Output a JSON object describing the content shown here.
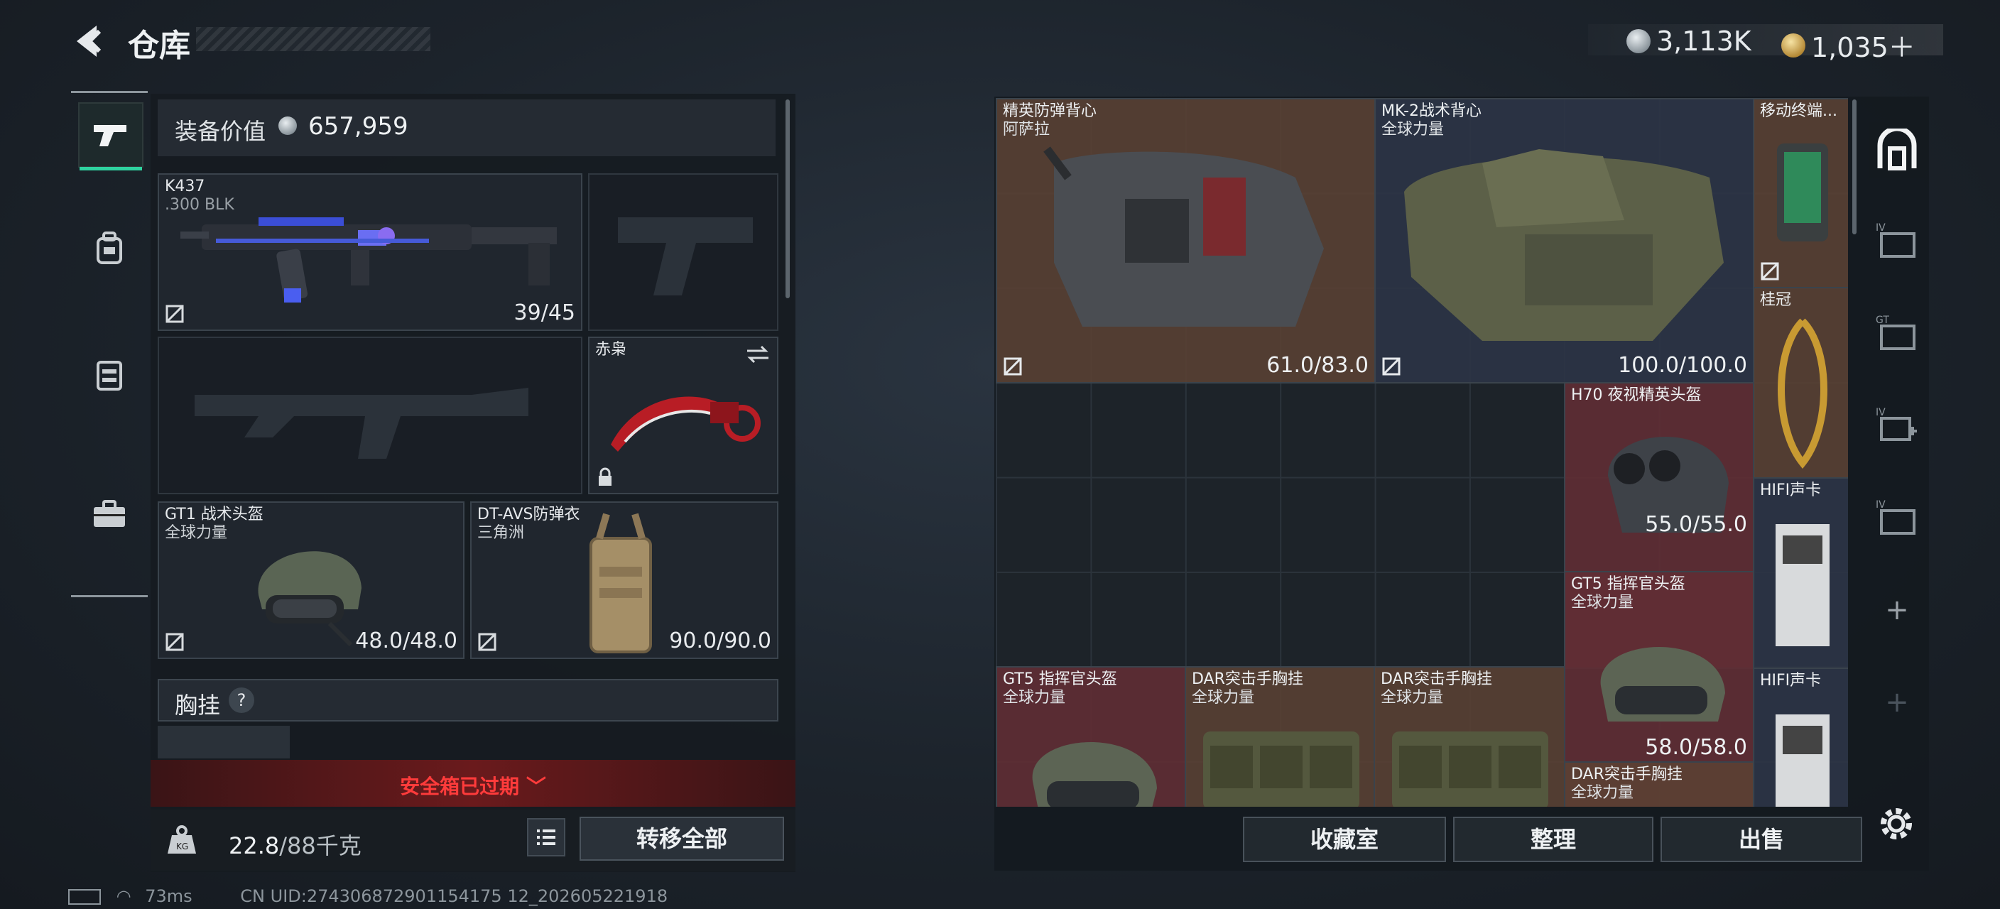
{
  "header": {
    "title": "仓库",
    "currency_silver": "3,113K",
    "currency_gold": "1,035＋"
  },
  "equip_value": {
    "label": "装备价值",
    "value": "657,959"
  },
  "slots": {
    "primary": {
      "name": "K437",
      "sub": ".300 BLK",
      "durability": "39/45"
    },
    "melee": {
      "name": "赤枭"
    },
    "helmet": {
      "name": "GT1 战术头盔",
      "sub": "全球力量",
      "durability": "48.0/48.0"
    },
    "armor": {
      "name": "DT-AVS防弹衣",
      "sub": "三角洲",
      "durability": "90.0/90.0"
    }
  },
  "chest_rig": {
    "label": "胸挂",
    "help": "?"
  },
  "safe_box": {
    "text": "安全箱已过期"
  },
  "weight": {
    "value": "22.8",
    "max": "/88千克"
  },
  "buttons": {
    "transfer_all": "转移全部",
    "collection": "收藏室",
    "organize": "整理",
    "sell": "出售"
  },
  "status": {
    "ping": "73ms",
    "uid": "CN UID:274306872901154175 12_202605221918"
  },
  "grid": [
    {
      "name": "精英防弹背心",
      "sub": "阿萨拉",
      "durability": "61.0/83.0",
      "color": "brown"
    },
    {
      "name": "MK-2战术背心",
      "sub": "全球力量",
      "durability": "100.0/100.0",
      "color": "blue"
    },
    {
      "name": "移动终端...",
      "sub": "",
      "durability": "",
      "color": "brown"
    },
    {
      "name": "桂冠",
      "sub": "",
      "durability": "",
      "color": "brown"
    },
    {
      "name": "H70 夜视精英头盔",
      "sub": "",
      "durability": "55.0/55.0",
      "color": "red"
    },
    {
      "name": "HIFI声卡",
      "sub": "",
      "durability": "",
      "color": "blue"
    },
    {
      "name": "GT5 指挥官头盔",
      "sub": "全球力量",
      "durability": "58.0/58.0",
      "color": "red"
    },
    {
      "name": "GT5 指挥官头盔",
      "sub": "全球力量",
      "durability": "",
      "color": "red"
    },
    {
      "name": "DAR突击手胸挂",
      "sub": "全球力量",
      "durability": "",
      "color": "brown"
    },
    {
      "name": "DAR突击手胸挂",
      "sub": "全球力量",
      "durability": "",
      "color": "brown"
    },
    {
      "name": "HIFI声卡",
      "sub": "",
      "durability": "",
      "color": "blue"
    },
    {
      "name": "DAR突击手胸挂",
      "sub": "全球力量",
      "durability": "",
      "color": "brown"
    }
  ],
  "colors": {
    "accent": "#2fd3a0",
    "warning": "#ff3b3b",
    "brown_cell": "#5c4234",
    "red_cell": "#602e34",
    "blue_cell": "#2c3446"
  }
}
